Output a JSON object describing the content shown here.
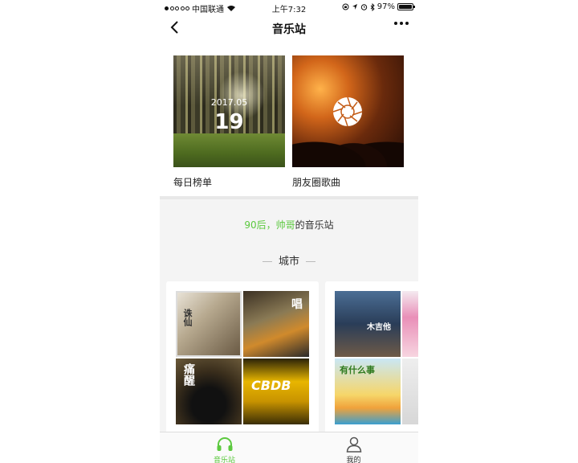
{
  "status_bar": {
    "carrier": "中国联通",
    "time": "上午7:32",
    "battery": "97%",
    "battery_level": 0.97
  },
  "nav": {
    "title": "音乐站"
  },
  "top_cards": [
    {
      "label": "每日榜单",
      "date": "2017.05",
      "day": "19"
    },
    {
      "label": "朋友圈歌曲"
    }
  ],
  "intro": {
    "prefix": "90后，帅哥",
    "suffix": "的音乐站"
  },
  "section": {
    "title": "城市"
  },
  "city_covers": {
    "c1": "诛仙",
    "c2": "唱",
    "c3": "痛醒",
    "c4": "CBDB",
    "c5": "木吉他",
    "c6": "有什么事"
  },
  "tabs": [
    {
      "label": "音乐站",
      "active": true,
      "icon": "headphones-icon"
    },
    {
      "label": "我的",
      "active": false,
      "icon": "person-icon"
    }
  ],
  "colors": {
    "accent": "#5cc93f"
  }
}
